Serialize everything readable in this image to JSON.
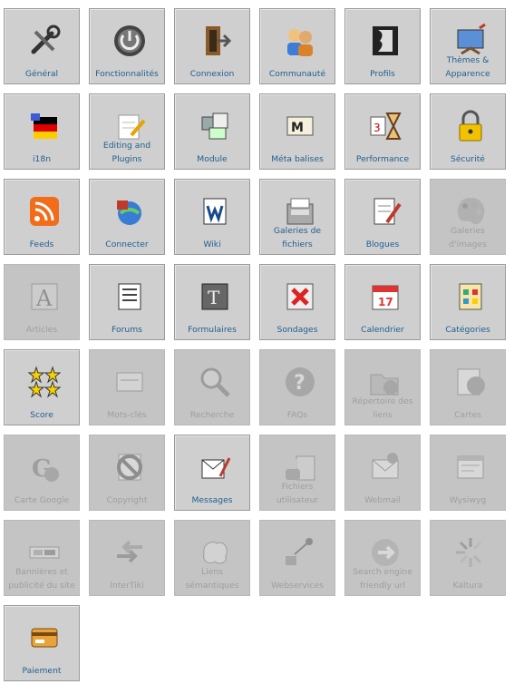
{
  "tiles": [
    {
      "label": "Général",
      "icon": "tools-icon",
      "active": true
    },
    {
      "label": "Fonctionnalités",
      "icon": "power-icon",
      "active": true
    },
    {
      "label": "Connexion",
      "icon": "door-enter-icon",
      "active": true
    },
    {
      "label": "Communauté",
      "icon": "users-icon",
      "active": true
    },
    {
      "label": "Profils",
      "icon": "profile-silhouette-icon",
      "active": true
    },
    {
      "label": "Thèmes & Apparence",
      "icon": "paint-canvas-icon",
      "active": true
    },
    {
      "label": "i18n",
      "icon": "flags-icon",
      "active": true
    },
    {
      "label": "Editing and Plugins",
      "icon": "notepad-pencil-icon",
      "active": true
    },
    {
      "label": "Module",
      "icon": "modules-icon",
      "active": true
    },
    {
      "label": "Méta balises",
      "icon": "meta-card-icon",
      "active": true
    },
    {
      "label": "Performance",
      "icon": "hourglass-calendar-icon",
      "active": true
    },
    {
      "label": "Sécurité",
      "icon": "padlock-icon",
      "active": true
    },
    {
      "label": "Feeds",
      "icon": "rss-icon",
      "active": true
    },
    {
      "label": "Connecter",
      "icon": "globe-plug-icon",
      "active": true
    },
    {
      "label": "Wiki",
      "icon": "wiki-icon",
      "active": true
    },
    {
      "label": "Galeries de fichiers",
      "icon": "file-cabinet-icon",
      "active": true
    },
    {
      "label": "Blogues",
      "icon": "blog-pencil-icon",
      "active": true
    },
    {
      "label": "Galeries d'images",
      "icon": "palette-icon",
      "active": false
    },
    {
      "label": "Articles",
      "icon": "article-letter-icon",
      "active": false
    },
    {
      "label": "Forums",
      "icon": "forum-document-icon",
      "active": true
    },
    {
      "label": "Formulaires",
      "icon": "form-book-icon",
      "active": true
    },
    {
      "label": "Sondages",
      "icon": "poll-x-icon",
      "active": true
    },
    {
      "label": "Calendrier",
      "icon": "calendar-icon",
      "active": true
    },
    {
      "label": "Catégories",
      "icon": "categories-icon",
      "active": true
    },
    {
      "label": "Score",
      "icon": "stars-icon",
      "active": true
    },
    {
      "label": "Mots-clés",
      "icon": "keyword-card-icon",
      "active": false
    },
    {
      "label": "Recherche",
      "icon": "magnifier-icon",
      "active": false
    },
    {
      "label": "FAQs",
      "icon": "question-icon",
      "active": false
    },
    {
      "label": "Répertoire des liens",
      "icon": "folder-globe-icon",
      "active": false
    },
    {
      "label": "Cartes",
      "icon": "map-globe-icon",
      "active": false
    },
    {
      "label": "Carte Google",
      "icon": "google-globe-icon",
      "active": false
    },
    {
      "label": "Copyright",
      "icon": "no-copy-icon",
      "active": false
    },
    {
      "label": "Messages",
      "icon": "messages-icon",
      "active": true
    },
    {
      "label": "Fichiers utilisateur",
      "icon": "user-files-icon",
      "active": false
    },
    {
      "label": "Webmail",
      "icon": "webmail-icon",
      "active": false
    },
    {
      "label": "Wysiwyg",
      "icon": "wysiwyg-icon",
      "active": false
    },
    {
      "label": "Bannières et publicité du site",
      "icon": "banner-icon",
      "active": false
    },
    {
      "label": "InterTiki",
      "icon": "arrows-exchange-icon",
      "active": false
    },
    {
      "label": "Liens sémantiques",
      "icon": "brain-icon",
      "active": false
    },
    {
      "label": "Webservices",
      "icon": "webservices-icon",
      "active": false
    },
    {
      "label": "Search engine friendly url",
      "icon": "sefurl-icon",
      "active": false
    },
    {
      "label": "Kaltura",
      "icon": "kaltura-icon",
      "active": false
    },
    {
      "label": "Paiement",
      "icon": "payment-card-icon",
      "active": true
    }
  ]
}
